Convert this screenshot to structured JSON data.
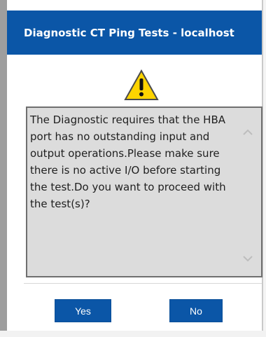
{
  "dialog": {
    "title": "Diagnostic CT Ping Tests - localhost",
    "icon": "warning-icon",
    "message": "The Diagnostic requires that the HBA port has no outstanding input and output operations.Please make sure there is no active I/O before starting the test.Do you want to proceed with the test(s)?",
    "buttons": {
      "yes_label": "Yes",
      "no_label": "No"
    }
  },
  "colors": {
    "title_bar": "#0b56a7",
    "button": "#0b56a7",
    "message_bg": "#dcdcdc"
  }
}
